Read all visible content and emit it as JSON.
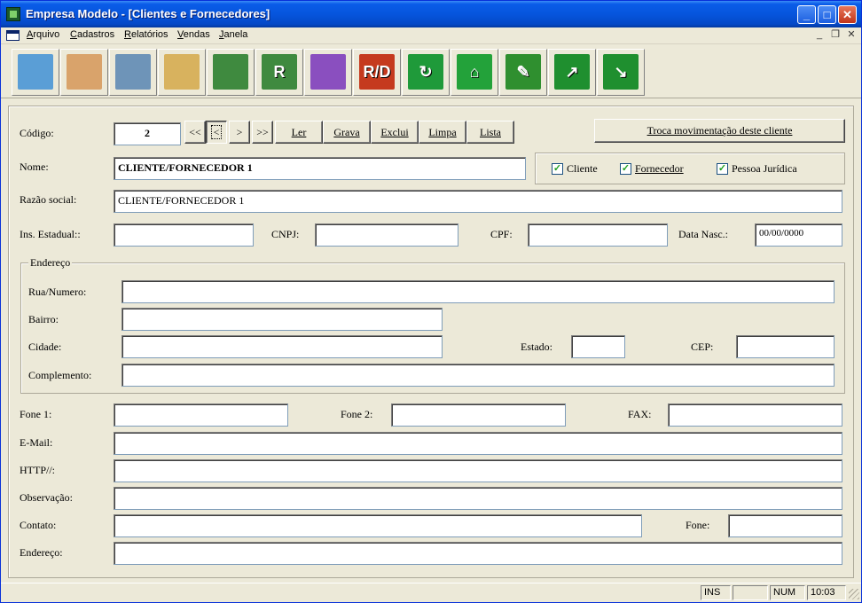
{
  "window": {
    "title": "Empresa Modelo - [Clientes e Fornecedores]"
  },
  "title_buttons": {
    "minimize": "_",
    "maximize": "□",
    "close": "✕"
  },
  "menu": [
    {
      "label": "Arquivo",
      "accel": "A",
      "rest": "rquivo"
    },
    {
      "label": "Cadastros",
      "accel": "C",
      "rest": "adastros"
    },
    {
      "label": "Relatórios",
      "accel": "R",
      "rest": "elatórios"
    },
    {
      "label": "Vendas",
      "accel": "V",
      "rest": "endas"
    },
    {
      "label": "Janela",
      "accel": "J",
      "rest": "anela"
    }
  ],
  "mdi_controls": {
    "minimize": "_",
    "restore": "❐",
    "close": "✕"
  },
  "toolbar": [
    {
      "icon": "map-icon",
      "color": "#5a9ed6",
      "glyph": ""
    },
    {
      "icon": "people-icon",
      "color": "#d9a36b",
      "glyph": ""
    },
    {
      "icon": "file-cabinet-icon",
      "color": "#6e94b8",
      "glyph": ""
    },
    {
      "icon": "folders-icon",
      "color": "#d8b25e",
      "glyph": ""
    },
    {
      "icon": "notepad-edit-icon",
      "color": "#3f8a3f",
      "glyph": ""
    },
    {
      "icon": "report-icon",
      "color": "#3f8a3f",
      "glyph": "R"
    },
    {
      "icon": "spreadsheet-icon",
      "color": "#8a4fbf",
      "glyph": ""
    },
    {
      "icon": "rd-stamp-icon",
      "color": "#c53a1e",
      "glyph": "R/D"
    },
    {
      "icon": "refresh-icon",
      "color": "#1f9a3a",
      "glyph": "↻"
    },
    {
      "icon": "home-icon",
      "color": "#23a23a",
      "glyph": "⌂"
    },
    {
      "icon": "pen-icon",
      "color": "#2f8f2f",
      "glyph": "✎"
    },
    {
      "icon": "chart-up-icon",
      "color": "#1f8f2f",
      "glyph": "↗"
    },
    {
      "icon": "chart-down-icon",
      "color": "#1f8f2f",
      "glyph": "↘"
    }
  ],
  "form": {
    "codigo_label": "Código:",
    "codigo_value": "2",
    "nav": {
      "first": "<<",
      "prev": "<",
      "next": ">",
      "last": ">>"
    },
    "buttons": {
      "ler": "Ler",
      "grava": "Grava",
      "exclui": "Exclui",
      "limpa": "Limpa",
      "lista": "Lista"
    },
    "troca_button": "Troca movimentação deste cliente",
    "nome_label": "Nome:",
    "nome_value": "CLIENTE/FORNECEDOR 1",
    "checkboxes": {
      "cliente": "Cliente",
      "fornecedor": "Fornecedor",
      "pessoa_juridica": "Pessoa Jurídica"
    },
    "checked_mark": "✓",
    "razao_label": "Razão social:",
    "razao_value": "CLIENTE/FORNECEDOR 1",
    "ie_label": "Ins. Estadual::",
    "cnpj_label": "CNPJ:",
    "cpf_label": "CPF:",
    "data_nasc_label": "Data Nasc.:",
    "data_nasc_value": "00/00/0000",
    "endereco_group": "Endereço",
    "rua_label": "Rua/Numero:",
    "bairro_label": "Bairro:",
    "cidade_label": "Cidade:",
    "estado_label": "Estado:",
    "cep_label": "CEP:",
    "complemento_label": "Complemento:",
    "fone1_label": "Fone 1:",
    "fone2_label": "Fone 2:",
    "fax_label": "FAX:",
    "email_label": "E-Mail:",
    "http_label": "HTTP//:",
    "obs_label": "Observação:",
    "contato_label": "Contato:",
    "fone_label": "Fone:",
    "endereco2_label": "Endereço:"
  },
  "status": {
    "ins": "INS",
    "num": "NUM",
    "time": "10:03"
  }
}
